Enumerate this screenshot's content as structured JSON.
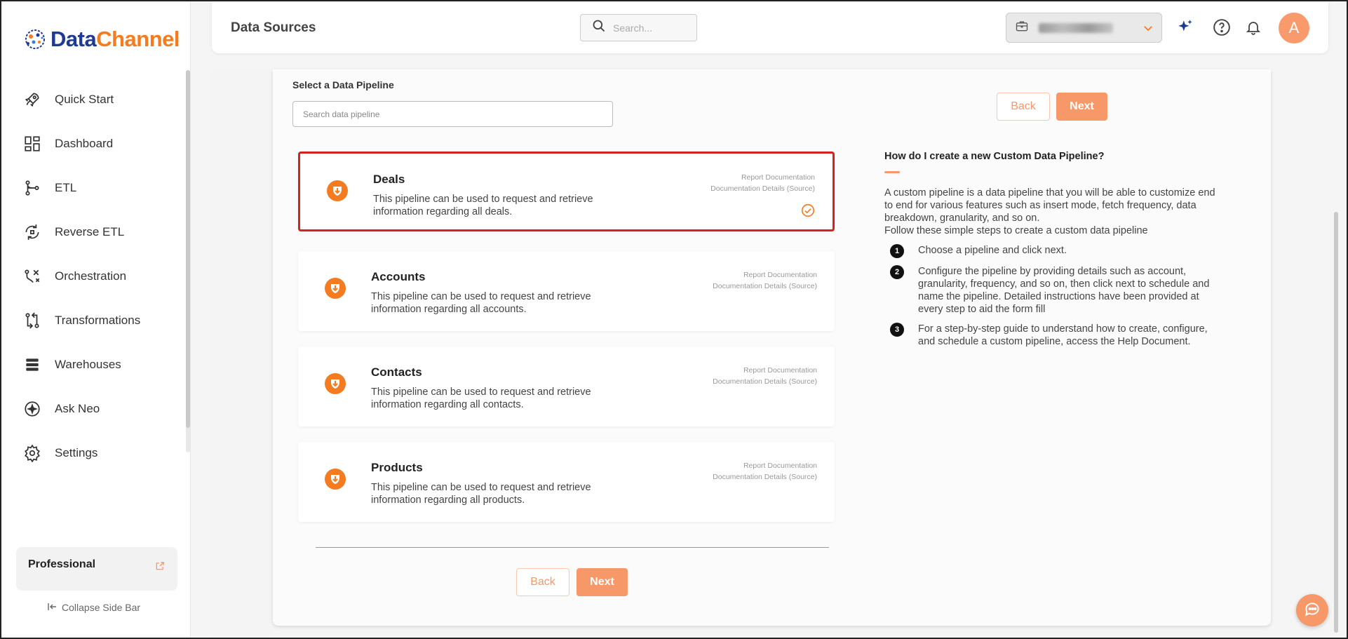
{
  "brand": {
    "name_part1": "Data",
    "name_part2": "Channel"
  },
  "sidebar": {
    "items": [
      {
        "label": "Quick Start",
        "icon": "rocket-icon"
      },
      {
        "label": "Dashboard",
        "icon": "dashboard-icon"
      },
      {
        "label": "ETL",
        "icon": "etl-icon"
      },
      {
        "label": "Reverse ETL",
        "icon": "reverse-etl-icon"
      },
      {
        "label": "Orchestration",
        "icon": "orchestration-icon"
      },
      {
        "label": "Transformations",
        "icon": "transformations-icon"
      },
      {
        "label": "Warehouses",
        "icon": "warehouse-icon"
      },
      {
        "label": "Ask Neo",
        "icon": "ask-neo-icon"
      },
      {
        "label": "Settings",
        "icon": "gear-icon"
      }
    ],
    "plan_label": "Professional",
    "collapse_label": "Collapse Side Bar"
  },
  "header": {
    "title": "Data Sources",
    "search_placeholder": "Search...",
    "avatar_letter": "A"
  },
  "main": {
    "select_label": "Select a Data Pipeline",
    "search_placeholder": "Search data pipeline",
    "back_label": "Back",
    "next_label": "Next",
    "pipelines": [
      {
        "title": "Deals",
        "desc": "This pipeline can be used to request and retrieve information regarding all deals.",
        "link1": "Report Documentation",
        "link2": "Documentation Details (Source)",
        "selected": true
      },
      {
        "title": "Accounts",
        "desc": "This pipeline can be used to request and retrieve information regarding all accounts.",
        "link1": "Report Documentation",
        "link2": "Documentation Details (Source)",
        "selected": false
      },
      {
        "title": "Contacts",
        "desc": "This pipeline can be used to request and retrieve information regarding all contacts.",
        "link1": "Report Documentation",
        "link2": "Documentation Details (Source)",
        "selected": false
      },
      {
        "title": "Products",
        "desc": "This pipeline can be used to request and retrieve information regarding all products.",
        "link1": "Report Documentation",
        "link2": "Documentation Details (Source)",
        "selected": false
      }
    ],
    "help": {
      "title": "How do I create a new Custom Data Pipeline?",
      "intro": "A custom pipeline is a data pipeline that you will be able to customize end to end for various features such as insert mode, fetch frequency, data breakdown, granularity, and so on.",
      "intro2": "Follow these simple steps to create a custom data pipeline",
      "steps": [
        {
          "num": "1",
          "text": "Choose a pipeline and click next."
        },
        {
          "num": "2",
          "text": "Configure the pipeline by providing details such as account, granularity, frequency, and so on, then click next to schedule and name the pipeline. Detailed instructions have been provided at every step to aid the form fill"
        },
        {
          "num": "3",
          "text": "For a step-by-step guide to understand how to create, configure, and schedule a custom pipeline, access the Help Document."
        }
      ]
    }
  },
  "colors": {
    "accent": "#f79868",
    "brand_blue": "#1f3a93",
    "brand_orange": "#f47b20",
    "selected_border": "#d32222"
  }
}
